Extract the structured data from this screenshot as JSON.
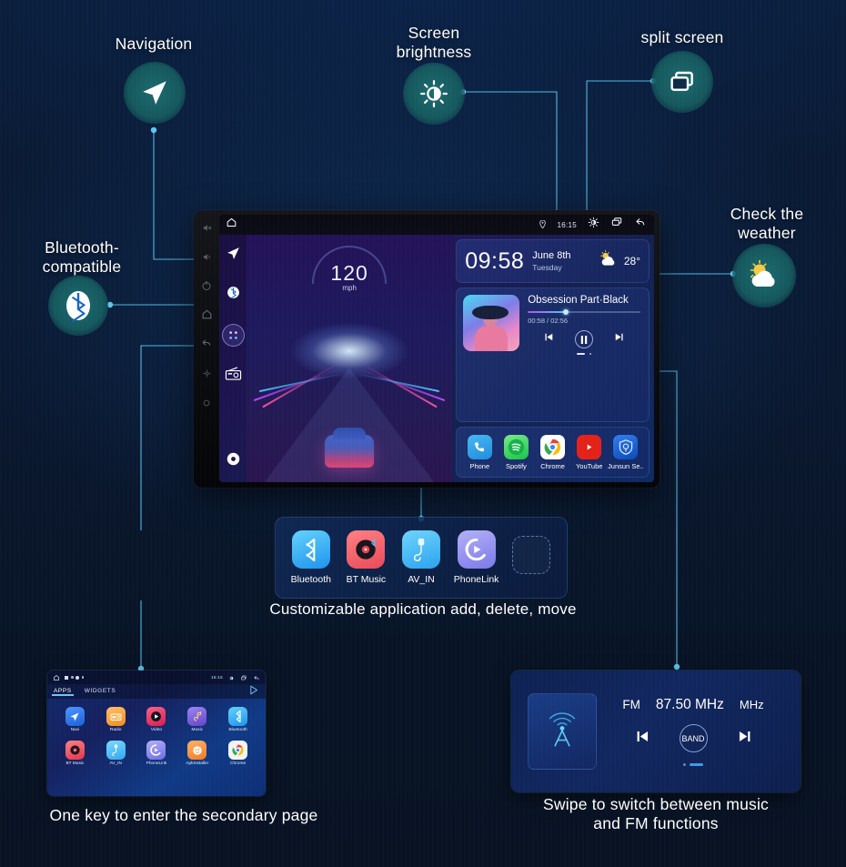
{
  "page": {
    "background_color": "#0a1628",
    "accent_line_color": "#5ec6f0",
    "badge_color": "#17666c"
  },
  "callouts": [
    {
      "key": "navigation",
      "label": "Navigation",
      "icon": "navigation-arrow-icon"
    },
    {
      "key": "screen_brightness",
      "label": "Screen\nbrightness",
      "icon": "brightness-icon"
    },
    {
      "key": "split_screen",
      "label": "split screen",
      "icon": "split-screen-icon"
    },
    {
      "key": "bluetooth",
      "label": "Bluetooth-\ncompatible",
      "icon": "bluetooth-icon"
    },
    {
      "key": "weather",
      "label": "Check the\nweather",
      "icon": "weather-partly-cloudy-icon"
    }
  ],
  "head_unit": {
    "status_bar": {
      "location_icon": "location-pin-icon",
      "time": "16:15",
      "brightness_icon": "brightness-icon",
      "split_screen_icon": "split-screen-icon",
      "back_icon": "back-arrow-icon",
      "home_icon": "home-icon"
    },
    "sidebar_items": [
      {
        "name": "navigation",
        "icon": "navigation-arrow-icon"
      },
      {
        "name": "bluetooth",
        "icon": "bluetooth-icon"
      },
      {
        "name": "apps",
        "icon": "apps-grid-icon"
      },
      {
        "name": "radio",
        "icon": "radio-icon"
      },
      {
        "name": "power",
        "icon": "power-circle-icon"
      }
    ],
    "bezel_buttons": [
      "mute-icon",
      "volume-icon",
      "power-icon",
      "home-icon",
      "back-icon",
      "settings-icon",
      "reset-icon"
    ],
    "drive_widget": {
      "speed": "120",
      "unit": "mph"
    },
    "clock_widget": {
      "time": "09:58",
      "date": "June 8th",
      "weekday": "Tuesday",
      "temperature": "28°",
      "weather_icon": "weather-partly-cloudy-icon"
    },
    "music_widget": {
      "track_title": "Obsession Part·Black",
      "elapsed_total": "00:58 / 02:56",
      "progress_percent": 34,
      "prev_icon": "skip-previous-icon",
      "play_pause_icon": "pause-icon",
      "next_icon": "skip-next-icon"
    },
    "app_row": [
      {
        "label": "Phone",
        "icon": "phone-icon",
        "color": "#2196f3"
      },
      {
        "label": "Spotify",
        "icon": "spotify-icon",
        "color": "#1db954"
      },
      {
        "label": "Chrome",
        "icon": "chrome-icon",
        "color": "#ffffff"
      },
      {
        "label": "YouTube",
        "icon": "youtube-icon",
        "color": "#e62117"
      },
      {
        "label": "Junsun Se..",
        "icon": "junsun-icon",
        "color": "#1565d8"
      }
    ]
  },
  "dock": {
    "caption": "Customizable application add, delete, move",
    "apps": [
      {
        "label": "Bluetooth",
        "icon": "bluetooth-icon",
        "color": "#3db6f5"
      },
      {
        "label": "BT Music",
        "icon": "bt-music-icon",
        "color": "#f0606a"
      },
      {
        "label": "AV_IN",
        "icon": "av-in-icon",
        "color": "#45b6f7"
      },
      {
        "label": "PhoneLink",
        "icon": "phonelink-icon",
        "color": "#8e8ef0"
      },
      {
        "label": "",
        "icon": "add-slot-icon",
        "color": ""
      }
    ]
  },
  "secondary_page": {
    "caption": "One key to enter the secondary page",
    "status_time": "16:15",
    "tabs": [
      {
        "label": "APPS",
        "active": true
      },
      {
        "label": "WIDGETS",
        "active": false
      }
    ],
    "play_store_icon": "play-store-icon",
    "apps": [
      {
        "label": "Navi",
        "icon": "navigation-arrow-icon",
        "color": "#2e7df6"
      },
      {
        "label": "Radio",
        "icon": "radio-icon",
        "color": "#f5a623"
      },
      {
        "label": "Video",
        "icon": "video-icon",
        "color": "#ef3e63"
      },
      {
        "label": "Music",
        "icon": "music-note-icon",
        "color": "#7b5fe0"
      },
      {
        "label": "Bluetooth",
        "icon": "bluetooth-icon",
        "color": "#3db6f5"
      },
      {
        "label": "BT Music",
        "icon": "bt-music-icon",
        "color": "#f0606a"
      },
      {
        "label": "AV_IN",
        "icon": "av-in-icon",
        "color": "#45b6f7"
      },
      {
        "label": "PhoneLink",
        "icon": "phonelink-icon",
        "color": "#8e8ef0"
      },
      {
        "label": "ApkInstaller",
        "icon": "apk-installer-icon",
        "color": "#f0873a"
      },
      {
        "label": "Chrome",
        "icon": "chrome-icon",
        "color": "#f2f2f2"
      }
    ]
  },
  "fm_panel": {
    "caption": "Swipe to switch between music\nand FM functions",
    "band": "FM",
    "frequency": "87.50 MHz",
    "unit": "MHz",
    "band_button": "BAND",
    "prev_icon": "skip-previous-icon",
    "next_icon": "skip-next-icon",
    "tower_icon": "radio-tower-icon",
    "page_dots": 2,
    "active_dot": 1
  }
}
